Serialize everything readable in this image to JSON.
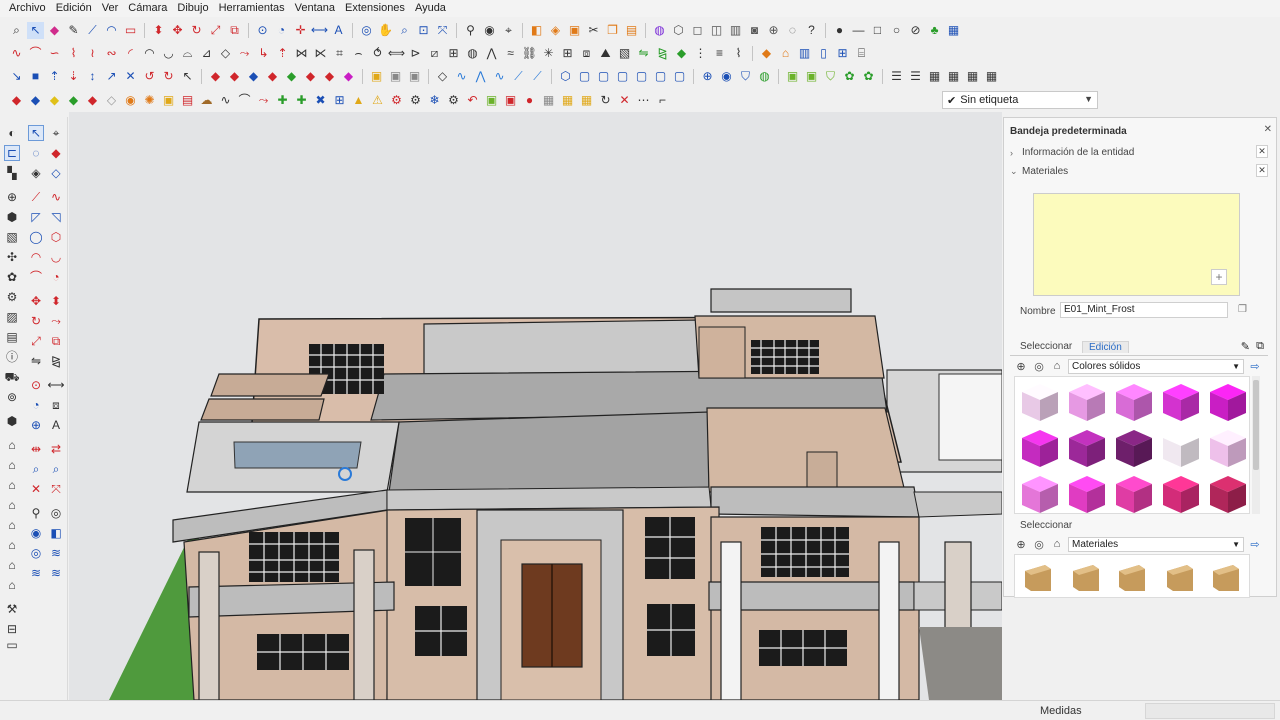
{
  "menu": {
    "items": [
      "Archivo",
      "Edición",
      "Ver",
      "Cámara",
      "Dibujo",
      "Herramientas",
      "Ventana",
      "Extensiones",
      "Ayuda"
    ]
  },
  "toolbar": {
    "label_filter": "Sin etiqueta"
  },
  "tray": {
    "title": "Bandeja predeterminada",
    "panels": {
      "entity_info": "Información de la entidad",
      "materials": "Materiales"
    },
    "material": {
      "name_label": "Nombre",
      "name_value": "E01_Mint_Frost",
      "preview_color": "#fcfbbd"
    },
    "tabs": {
      "select": "Seleccionar",
      "edit": "Edición"
    },
    "collection_primary": "Colores sólidos",
    "secondary_label": "Seleccionar",
    "collection_secondary": "Materiales",
    "swatches": [
      "#e8c9e6",
      "#e699e3",
      "#d86cd6",
      "#d333cf",
      "#c91ec4",
      "#c42bbf",
      "#9c2899",
      "#6e1f6b",
      "#f0e8f0",
      "#eec0ea",
      "#e476d8",
      "#e03cc2",
      "#df3ca4",
      "#d32c79",
      "#b0265a"
    ]
  },
  "status": {
    "measures_label": "Medidas"
  }
}
